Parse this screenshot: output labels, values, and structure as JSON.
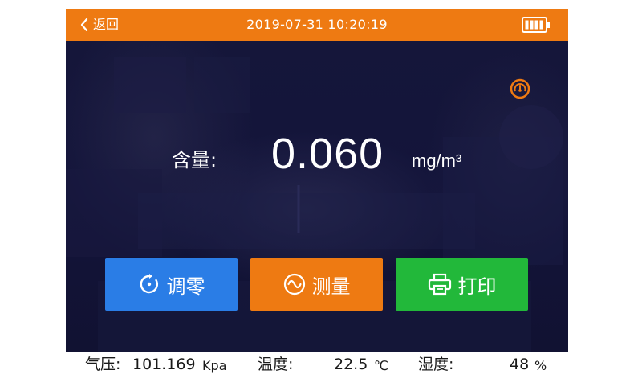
{
  "header": {
    "back_label": "返回",
    "datetime": "2019-07-31 10:20:19",
    "battery_icon": "battery-full-icon"
  },
  "colors": {
    "header_bg": "#ee7a12",
    "screen_bg": "#14153a",
    "zero_button": "#2a7de6",
    "measure_button": "#ee7a12",
    "print_button": "#22b83a"
  },
  "main": {
    "content_label": "含量:",
    "value": "0.060",
    "unit": "mg/m³",
    "gauge_icon": "gauge-icon"
  },
  "buttons": {
    "zero": {
      "label": "调零",
      "icon": "refresh-icon"
    },
    "measure": {
      "label": "测量",
      "icon": "wave-icon"
    },
    "print": {
      "label": "打印",
      "icon": "printer-icon"
    }
  },
  "status": {
    "pressure_label": "气压:",
    "pressure_value": "101.169",
    "pressure_unit": "Kpa",
    "temp_label": "温度:",
    "temp_value": "22.5",
    "temp_unit": "℃",
    "humidity_label": "湿度:",
    "humidity_value": "48",
    "humidity_unit": "%"
  }
}
